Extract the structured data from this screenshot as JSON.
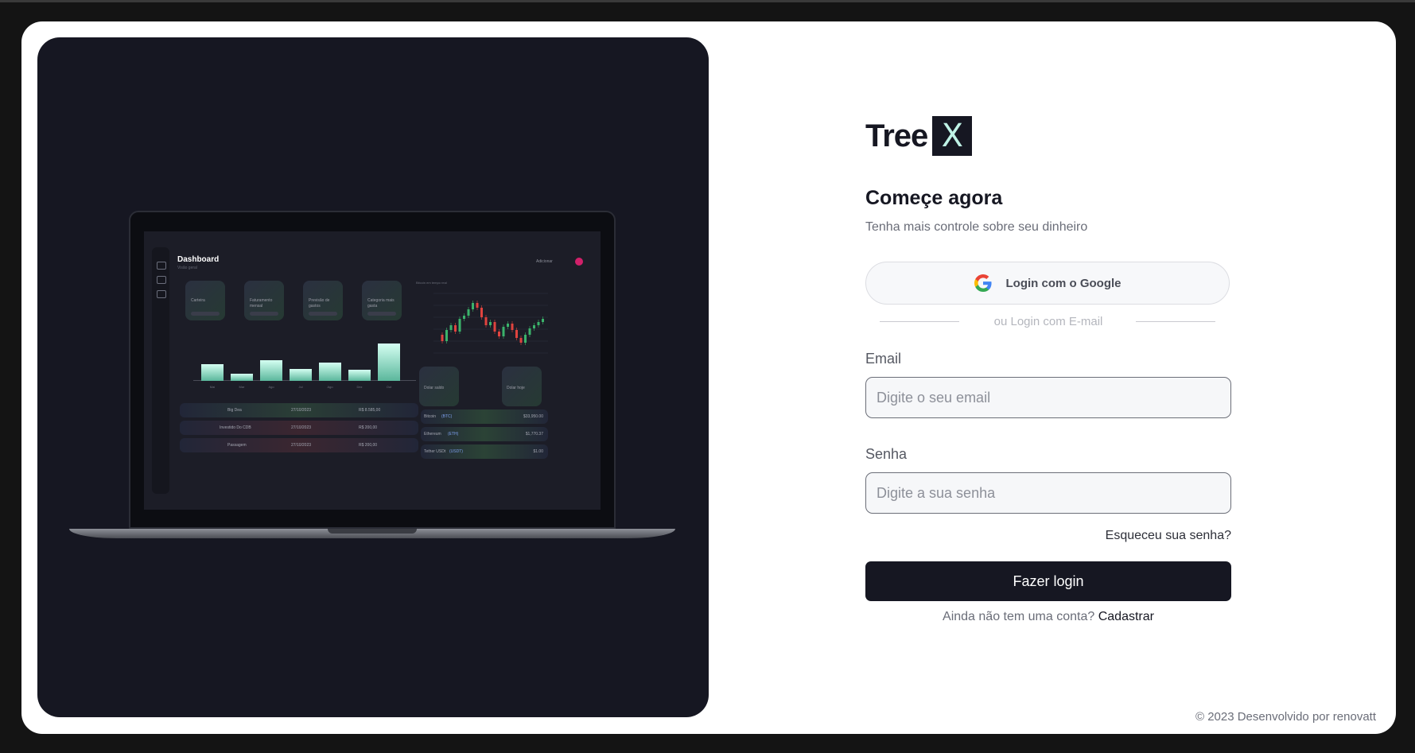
{
  "hero": {
    "dashboard": {
      "title": "Dashboard",
      "subtitle": "Visão geral",
      "add_label": "Adicionar",
      "cards": [
        "Carteira",
        "Faturamento mensal",
        "Previsão de gastos",
        "Categoria mais gasta"
      ],
      "bar_months": [
        "Mai",
        "Mar",
        "Ago",
        "Jul",
        "Ago",
        "Dez",
        "Out"
      ],
      "bar_values": [
        0.4,
        0.18,
        0.5,
        0.28,
        0.45,
        0.26,
        0.9
      ],
      "candle_title": "Bitcoin em tempo real",
      "wallets": [
        "Dolar saldo",
        "Dolar hoje"
      ],
      "transactions": [
        {
          "name": "Big Dea",
          "date": "27/10/2023",
          "value": "R$ 8.585,00"
        },
        {
          "name": "Investido Do CDB",
          "date": "27/10/2023",
          "value": "R$ 200,00"
        },
        {
          "name": "Passagem",
          "date": "27/10/2023",
          "value": "R$ 200,00"
        }
      ],
      "crypto": [
        {
          "name": "Bitcoin",
          "ticker": "(BTC)",
          "value": "$33,950.00"
        },
        {
          "name": "Ethereum",
          "ticker": "(ETH)",
          "value": "$1,770.37"
        },
        {
          "name": "Tether USDt",
          "ticker": "(USDT)",
          "value": "$1.00"
        }
      ]
    }
  },
  "logo": {
    "text": "Tree",
    "mark": "X"
  },
  "heading": "Começe agora",
  "subheading": "Tenha mais controle sobre seu dinheiro",
  "google_button": "Login com o Google",
  "divider": "ou Login com E-mail",
  "email": {
    "label": "Email",
    "placeholder": "Digite o seu email",
    "value": ""
  },
  "password": {
    "label": "Senha",
    "placeholder": "Digite a sua senha",
    "value": ""
  },
  "forgot": "Esqueceu sua senha?",
  "login_button": "Fazer login",
  "signup": {
    "prompt": "Ainda não tem uma conta?",
    "link": "Cadastrar"
  },
  "footer": "© 2023 Desenvolvido por renovatt",
  "colors": {
    "dark": "#161722",
    "accent": "#bff3e6",
    "page_bg": "#141414"
  }
}
